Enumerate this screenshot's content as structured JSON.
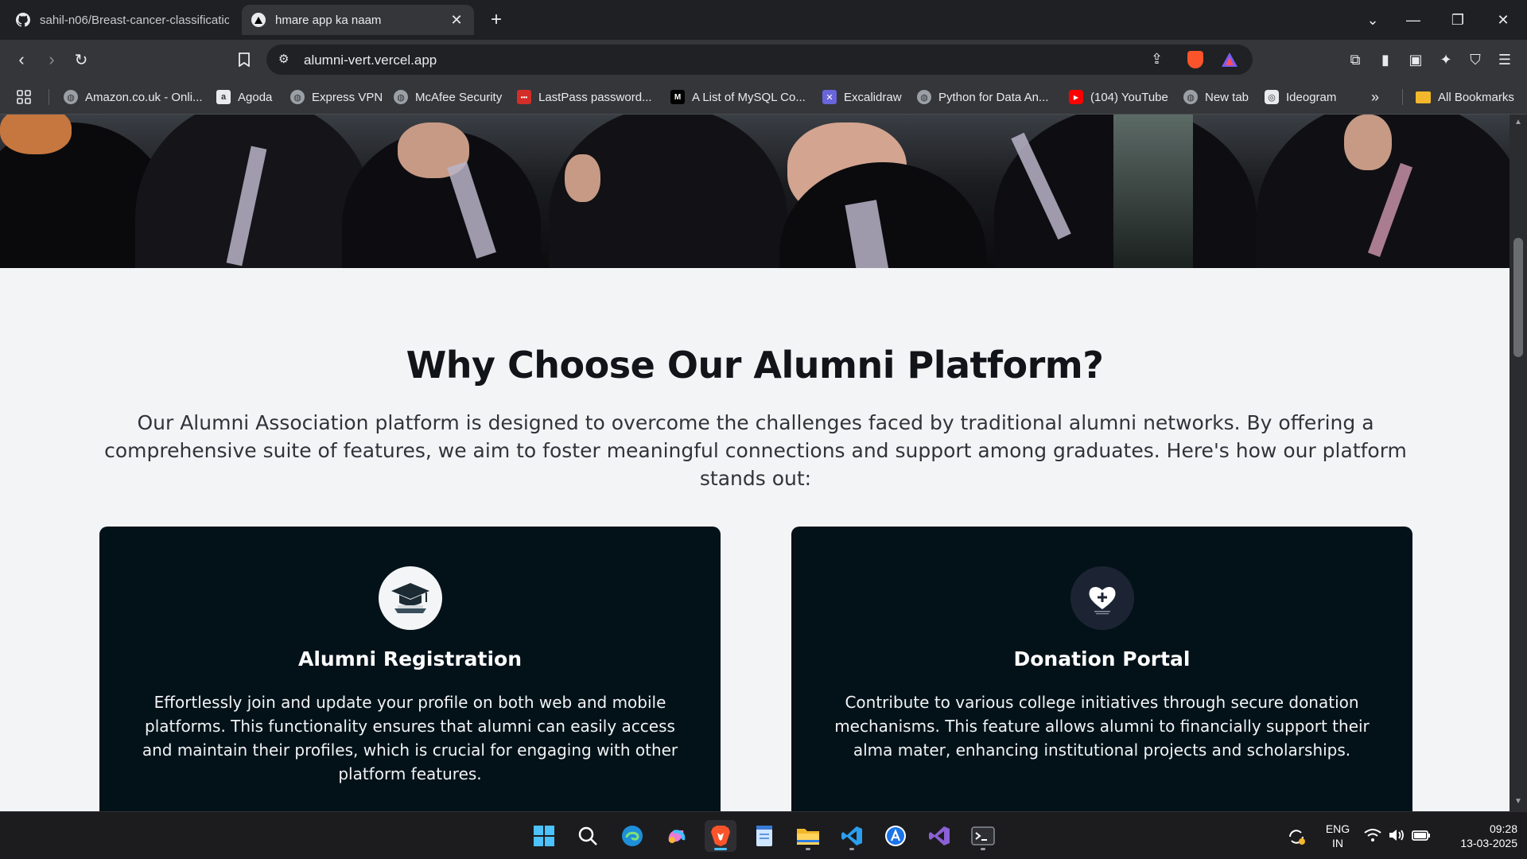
{
  "browser": {
    "tabs": [
      {
        "title": "sahil-n06/Breast-cancer-classificatio",
        "icon": "github-icon",
        "active": false
      },
      {
        "title": "hmare app ka naam",
        "icon": "vercel-icon",
        "active": true
      }
    ],
    "url": "alumni-vert.vercel.app",
    "bookmarks": [
      {
        "label": "Amazon.co.uk - Onli...",
        "icon": "globe-icon"
      },
      {
        "label": "Agoda",
        "icon": "agoda-icon"
      },
      {
        "label": "Express VPN",
        "icon": "globe-icon"
      },
      {
        "label": "McAfee Security",
        "icon": "globe-icon"
      },
      {
        "label": "LastPass password...",
        "icon": "lastpass-icon"
      },
      {
        "label": "A List of MySQL Co...",
        "icon": "medium-icon"
      },
      {
        "label": "Excalidraw",
        "icon": "excalidraw-icon"
      },
      {
        "label": "Python for Data An...",
        "icon": "globe-icon"
      },
      {
        "label": "(104) YouTube",
        "icon": "youtube-icon"
      },
      {
        "label": "New tab",
        "icon": "globe-icon"
      },
      {
        "label": "Ideogram",
        "icon": "ideogram-icon"
      }
    ],
    "all_bookmarks_label": "All Bookmarks"
  },
  "page": {
    "why_title": "Why Choose Our Alumni Platform?",
    "why_description": "Our Alumni Association platform is designed to overcome the challenges faced by traditional alumni networks. By offering a comprehensive suite of features, we aim to foster meaningful connections and support among graduates. Here's how our platform stands out:",
    "features": [
      {
        "title": "Alumni Registration",
        "icon": "graduation-cap-icon",
        "description": "Effortlessly join and update your profile on both web and mobile platforms. This functionality ensures that alumni can easily access and maintain their profiles, which is crucial for engaging with other platform features."
      },
      {
        "title": "Donation Portal",
        "icon": "heart-donation-icon",
        "description": "Contribute to various college initiatives through secure donation mechanisms. This feature allows alumni to financially support their alma mater, enhancing institutional projects and scholarships."
      }
    ]
  },
  "taskbar": {
    "apps": [
      "windows-start-icon",
      "search-icon",
      "edge-icon",
      "copilot-icon",
      "brave-icon",
      "notepad-icon",
      "file-explorer-icon",
      "vscode-icon",
      "app-store-icon",
      "visual-studio-icon",
      "terminal-icon"
    ],
    "lang_line1": "ENG",
    "lang_line2": "IN",
    "time": "09:28",
    "date": "13-03-2025"
  },
  "colors": {
    "page_bg": "#f3f4f6",
    "card_bg": "#031219",
    "title_text": "#111418",
    "browser_chrome": "#35363a"
  }
}
